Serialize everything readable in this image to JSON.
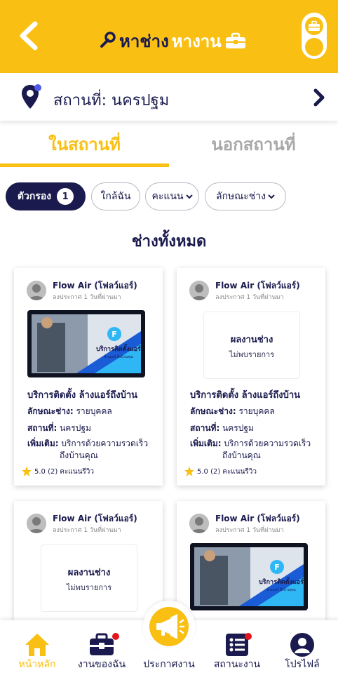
{
  "header": {
    "logo_part1": "หาช่าง",
    "logo_part2": "หางาน",
    "back_icon": "chevron-left-icon",
    "logo_icon": "wrench-icon",
    "toolbox_icon": "toolbox-icon"
  },
  "location": {
    "text": "สถานที่: นครปฐม",
    "icon": "location-pin-icon"
  },
  "tabs": [
    {
      "label": "ในสถานที่",
      "active": true
    },
    {
      "label": "นอกสถานที่",
      "active": false
    }
  ],
  "filters": {
    "filter_label": "ตัวกรอง",
    "filter_count": "1",
    "near_label": "ใกล้ฉัน",
    "score_label": "คะแนน",
    "type_label": "ลักษณะช่าง"
  },
  "section_title": "ช่างทั้งหมด",
  "cards": [
    {
      "name": "Flow Air (โฟลว์แอร์)",
      "time": "ลงประกาศ 1 วันที่ผ่านมา",
      "has_photo": true,
      "photo_caption": "บริการติดตั้งแอร์",
      "photo_subcaption": "ล้างแอร์ ถึงบ้านคุณ",
      "title": "บริการติดตั้ง ล้างแอร์ถึงบ้าน",
      "type_label": "ลักษณะช่าง:",
      "type_value": "รายบุคคล",
      "place_label": "สถานที่:",
      "place_value": "นครปฐม",
      "extra_label": "เพิ่มเติม:",
      "extra_value_1": "บริการด้วยความรวดเร็ว",
      "extra_value_2": "ถึงบ้านคุณ",
      "rating": "5.0 (2)",
      "rating_label": "คะแนนรีวิว"
    },
    {
      "name": "Flow Air (โฟลว์แอร์)",
      "time": "ลงประกาศ 1 วันที่ผ่านมา",
      "has_photo": false,
      "ph_title": "ผลงานช่าง",
      "ph_sub": "ไม่พบรายการ",
      "title": "บริการติดตั้ง ล้างแอร์ถึงบ้าน",
      "type_label": "ลักษณะช่าง:",
      "type_value": "รายบุคคล",
      "place_label": "สถานที่:",
      "place_value": "นครปฐม",
      "extra_label": "เพิ่มเติม:",
      "extra_value_1": "บริการด้วยความรวดเร็ว",
      "extra_value_2": "ถึงบ้านคุณ",
      "rating": "5.0 (2)",
      "rating_label": "คะแนนรีวิว"
    },
    {
      "name": "Flow Air (โฟลว์แอร์)",
      "time": "ลงประกาศ 1 วันที่ผ่านมา",
      "has_photo": false,
      "ph_title": "ผลงานช่าง",
      "ph_sub": "ไม่พบรายการ"
    },
    {
      "name": "Flow Air (โฟลว์แอร์)",
      "time": "ลงประกาศ 1 วันที่ผ่านมา",
      "has_photo": true,
      "photo_caption": "บริการติดตั้งแอร์",
      "photo_subcaption": "ล้างแอร์ ถึงบ้านคุณ"
    }
  ],
  "bottom_nav": {
    "home": "หน้าหลัก",
    "my_jobs": "งานของฉัน",
    "announce": "ประกาศงาน",
    "status": "สถานะงาน",
    "profile": "โปรไฟล์"
  },
  "colors": {
    "brand_yellow": "#f9c013",
    "navy": "#1a1a4e",
    "badge_red": "#e4141c"
  }
}
